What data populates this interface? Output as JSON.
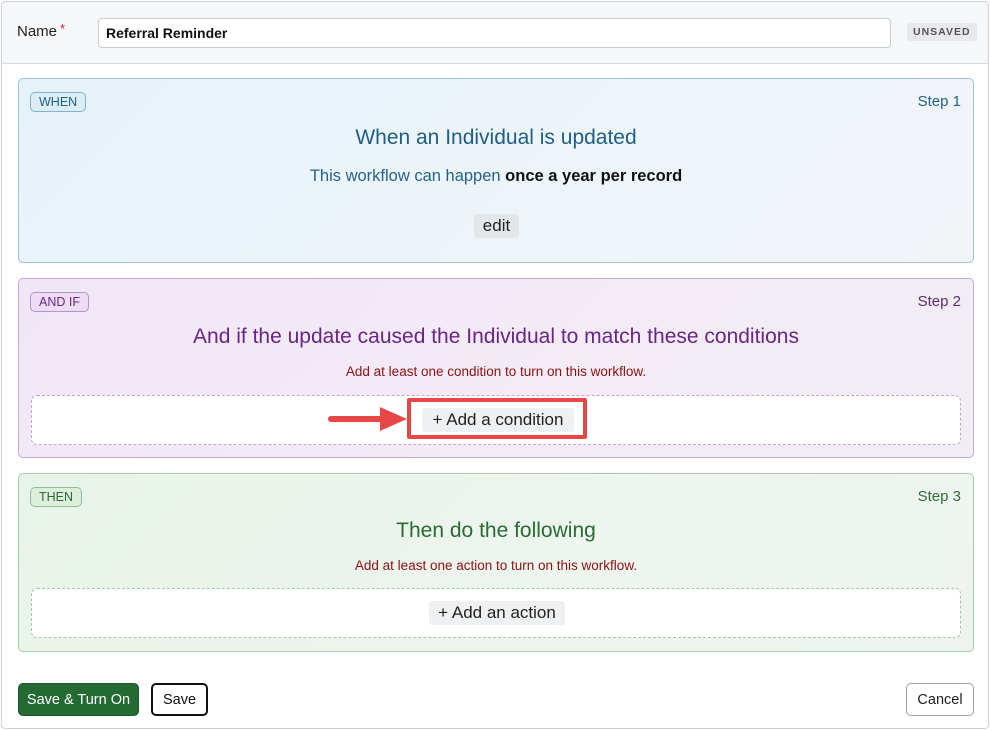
{
  "header": {
    "name_label": "Name",
    "required_marker": "*",
    "name_value": "Referral Reminder",
    "status_badge": "UNSAVED"
  },
  "when": {
    "tag": "WHEN",
    "step": "Step 1",
    "title": "When an Individual is updated",
    "frequency_prefix": "This workflow can happen",
    "frequency_value": "once a year per record",
    "edit_label": "edit"
  },
  "and_if": {
    "tag": "AND IF",
    "step": "Step 2",
    "title": "And if the update caused the Individual to match these conditions",
    "warning": "Add at least one condition to turn on this workflow.",
    "add_label": "+ Add a condition"
  },
  "then": {
    "tag": "THEN",
    "step": "Step 3",
    "title": "Then do the following",
    "warning": "Add at least one action to turn on this workflow.",
    "add_label": "+ Add an action"
  },
  "footer": {
    "save_turn_on": "Save & Turn On",
    "save": "Save",
    "cancel": "Cancel"
  },
  "colors": {
    "primary_green": "#236b33",
    "annotation_red": "#e94747",
    "warning_red": "#8b1212"
  }
}
